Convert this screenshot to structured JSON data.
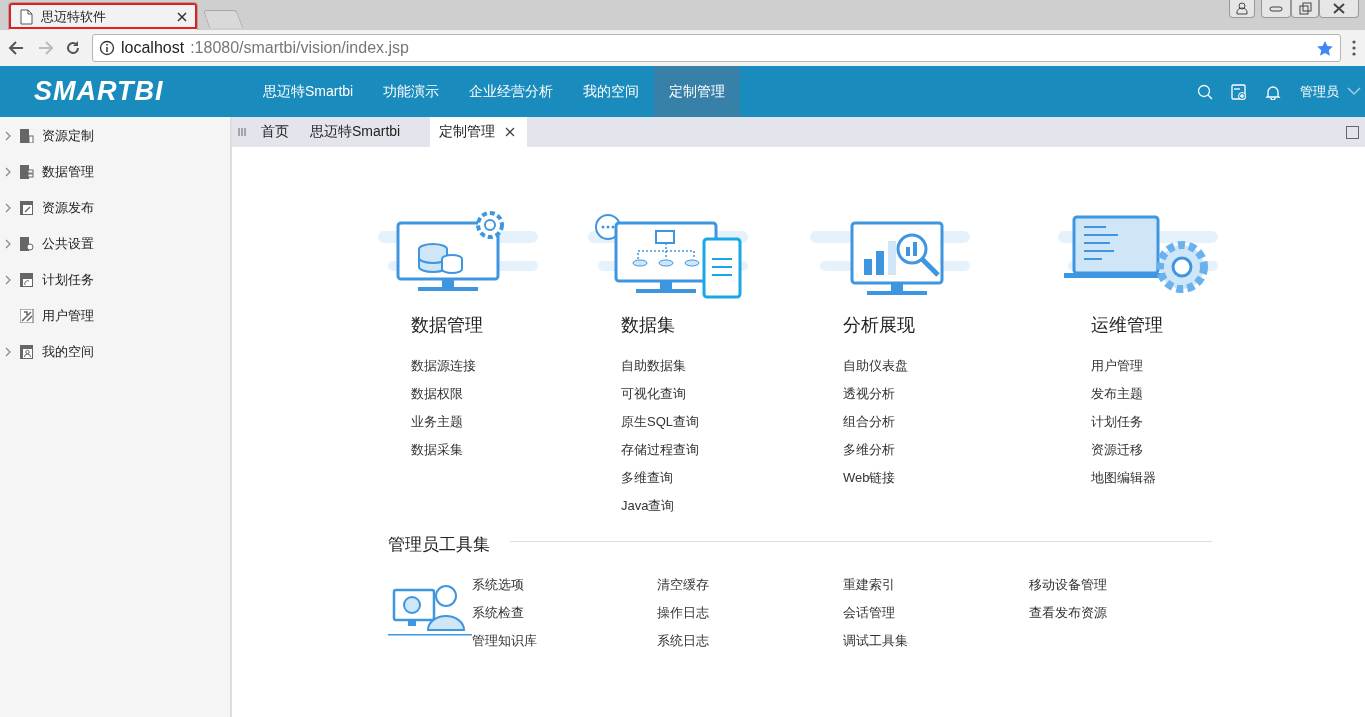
{
  "browser": {
    "tabs": [
      {
        "kind": "page",
        "title": "思迈特软件",
        "selected": true
      },
      {
        "kind": "new",
        "selected": false
      }
    ],
    "url": {
      "host": "localhost",
      "path": ":18080/smartbi/vision/index.jsp"
    }
  },
  "nav": {
    "logo": "SMARTBI",
    "items": [
      {
        "label": "思迈特Smartbi",
        "selected": false
      },
      {
        "label": "功能演示",
        "selected": false
      },
      {
        "label": "企业经营分析",
        "selected": false
      },
      {
        "label": "我的空间",
        "selected": false
      },
      {
        "label": "定制管理",
        "selected": true
      }
    ],
    "user": "管理员"
  },
  "sidebar": {
    "items": [
      {
        "label": "资源定制",
        "expandable": true
      },
      {
        "label": "数据管理",
        "expandable": true
      },
      {
        "label": "资源发布",
        "expandable": true
      },
      {
        "label": "公共设置",
        "expandable": true
      },
      {
        "label": "计划任务",
        "expandable": true
      },
      {
        "label": "用户管理",
        "expandable": false
      },
      {
        "label": "我的空间",
        "expandable": true
      }
    ]
  },
  "tabs": [
    {
      "label": "首页",
      "selected": false,
      "closable": false
    },
    {
      "label": "思迈特Smartbi",
      "selected": false,
      "closable": false
    },
    {
      "label": "定制管理",
      "selected": true,
      "closable": true
    }
  ],
  "categories": [
    {
      "kind": "database",
      "title": "数据管理",
      "links": [
        "数据源连接",
        "数据权限",
        "业务主题",
        "数据采集"
      ]
    },
    {
      "kind": "dataset",
      "title": "数据集",
      "links": [
        "自助数据集",
        "可视化查询",
        "原生SQL查询",
        "存储过程查询",
        "多维查询",
        "Java查询"
      ]
    },
    {
      "kind": "analysis",
      "title": "分析展现",
      "links": [
        "自助仪表盘",
        "透视分析",
        "组合分析",
        "多维分析",
        "Web链接"
      ]
    },
    {
      "kind": "ops",
      "title": "运维管理",
      "links": [
        "用户管理",
        "发布主题",
        "计划任务",
        "资源迁移",
        "地图编辑器"
      ]
    }
  ],
  "tools": {
    "title": "管理员工具集",
    "columns": [
      [
        "系统选项",
        "系统检查",
        "管理知识库"
      ],
      [
        "清空缓存",
        "操作日志",
        "系统日志"
      ],
      [
        "重建索引",
        "会话管理",
        "调试工具集"
      ],
      [
        "移动设备管理",
        "查看发布资源"
      ]
    ]
  }
}
